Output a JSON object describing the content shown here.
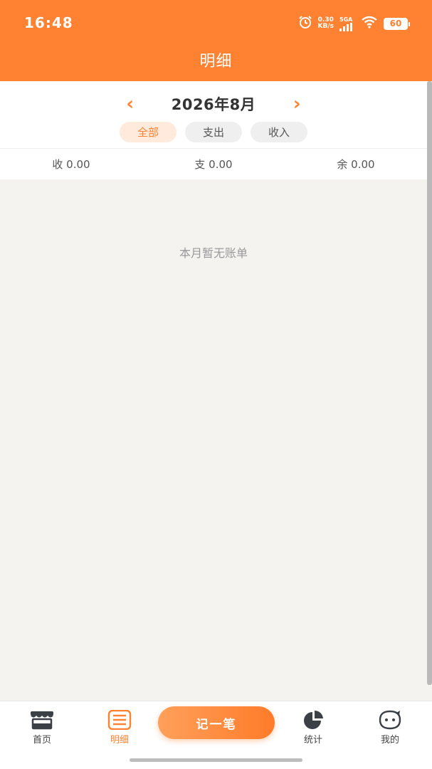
{
  "status_bar": {
    "time": "16:48",
    "net_speed_value": "0.30",
    "net_speed_unit": "KB/s",
    "network_type": "5GA",
    "battery": "60",
    "icons": [
      "alarm-icon",
      "signal-icon",
      "wifi-icon",
      "battery-icon"
    ]
  },
  "header": {
    "title": "明细"
  },
  "month_selector": {
    "prev": "‹",
    "label": "2026年8月",
    "next": "›"
  },
  "filters": [
    {
      "label": "全部",
      "active": true
    },
    {
      "label": "支出",
      "active": false
    },
    {
      "label": "收入",
      "active": false
    }
  ],
  "summary": {
    "income": "收 0.00",
    "expense": "支 0.00",
    "balance": "余 0.00"
  },
  "empty_state": {
    "text": "本月暂无账单"
  },
  "tabbar": {
    "home": "首页",
    "detail": "明细",
    "record_button": "记一笔",
    "stats": "统计",
    "mine": "我的",
    "active": "detail"
  },
  "colors": {
    "accent": "#ff8232",
    "background": "#f4f3ef",
    "chip_active_bg": "#ffeadb"
  }
}
